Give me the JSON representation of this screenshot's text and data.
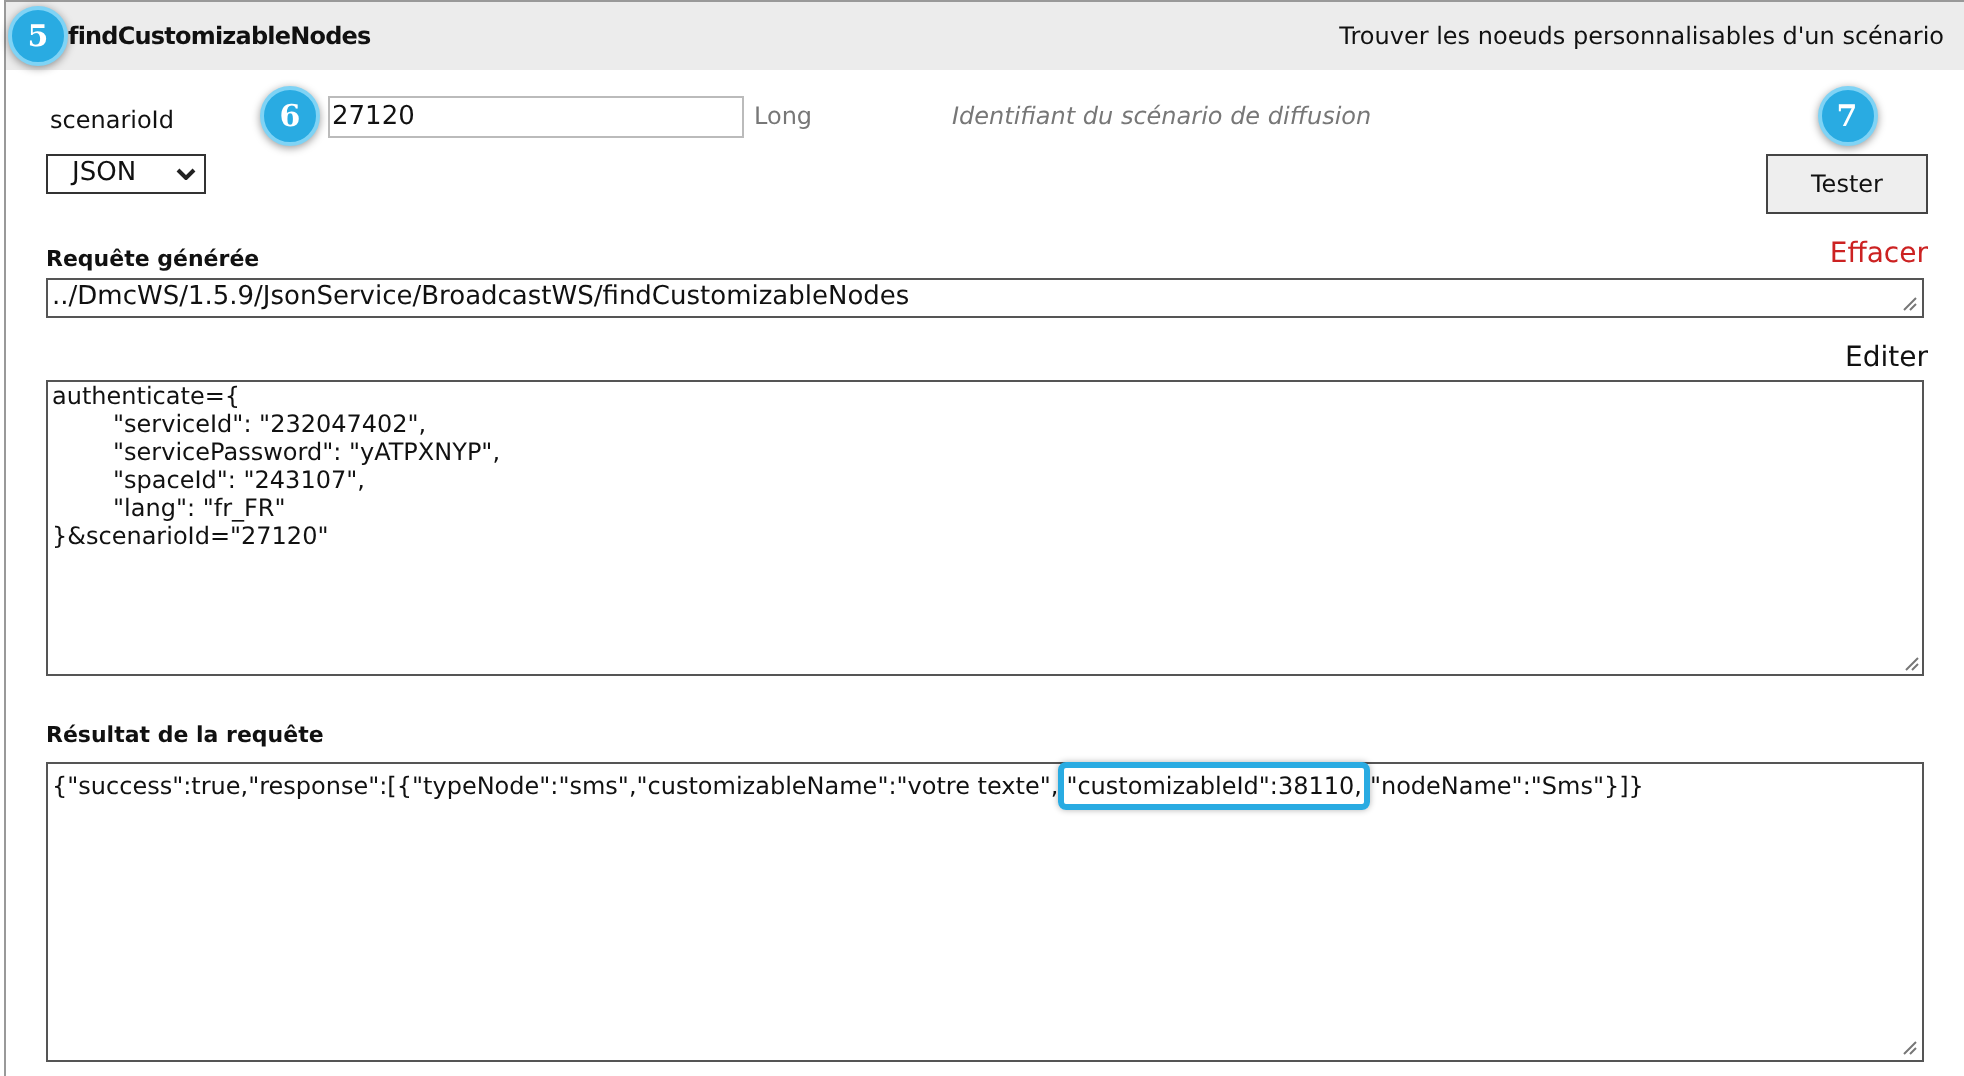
{
  "header": {
    "badge": "5",
    "title": "findCustomizableNodes",
    "description": "Trouver les noeuds personnalisables d'un scénario"
  },
  "param": {
    "label": "scenarioId",
    "badge": "6",
    "value": "27120",
    "type": "Long",
    "description": "Identifiant du scénario de diffusion"
  },
  "format": {
    "value": "JSON"
  },
  "test": {
    "badge": "7",
    "label": "Tester"
  },
  "request": {
    "label": "Requête générée",
    "clear": "Effacer",
    "url": "../DmcWS/1.5.9/JsonService/BroadcastWS/findCustomizableNodes",
    "edit": "Editer",
    "body": "authenticate={\n\t\"serviceId\": \"232047402\",\n\t\"servicePassword\": \"yATPXNYP\",\n\t\"spaceId\": \"243107\",\n\t\"lang\": \"fr_FR\"\n}&scenarioId=\"27120\""
  },
  "result": {
    "label": "Résultat de la requête",
    "segments": [
      {
        "text": "{\"success\":true,\"response\":[{\"typeNode\":\"sms\",\"customizableName\":\"votre texte\",",
        "highlighted": false
      },
      {
        "text": "\"customizableId\":38110,",
        "highlighted": true
      },
      {
        "text": "\"nodeName\":\"Sms\"}]}",
        "highlighted": false
      }
    ]
  }
}
